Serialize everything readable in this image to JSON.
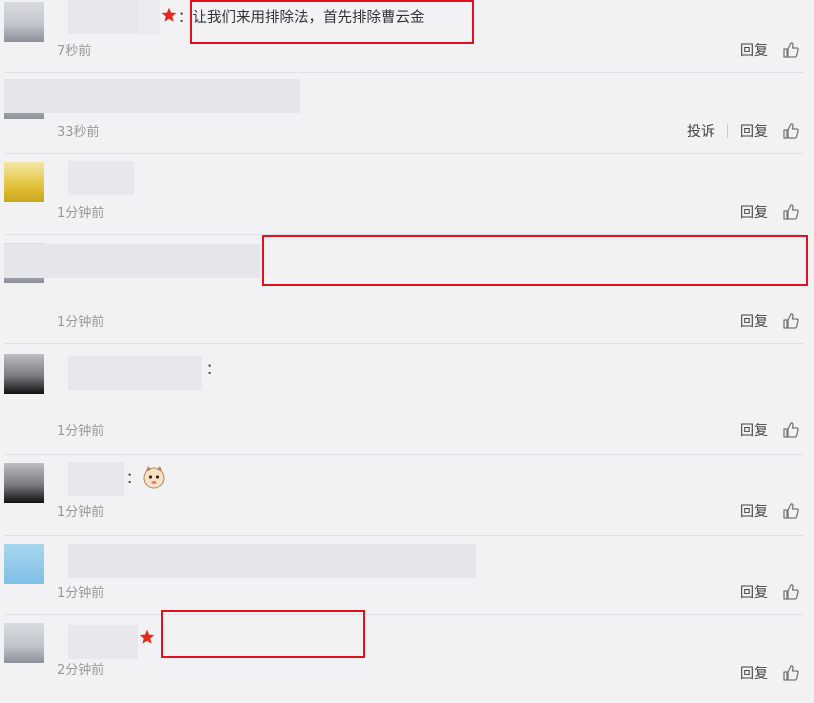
{
  "labels": {
    "report": "投诉",
    "reply": "回复"
  },
  "colors": {
    "highlight_border": "#e4101e",
    "vip_star": "#e5291d",
    "page_bg": "#f2f2f5"
  },
  "icons": {
    "like": "thumb-up-icon",
    "vip": "star-icon",
    "emoji": "cat-face-emoji"
  },
  "comments": [
    {
      "text": "让我们来用排除法，首先排除曹云金",
      "time": "7秒前"
    },
    {
      "text": "",
      "time": "33秒前"
    },
    {
      "text": "",
      "time": "1分钟前"
    },
    {
      "text": "",
      "time": "1分钟前"
    },
    {
      "text": "",
      "time": "1分钟前"
    },
    {
      "text": "",
      "time": "1分钟前"
    },
    {
      "text": "",
      "time": "1分钟前"
    },
    {
      "text": "",
      "time": "2分钟前"
    }
  ]
}
